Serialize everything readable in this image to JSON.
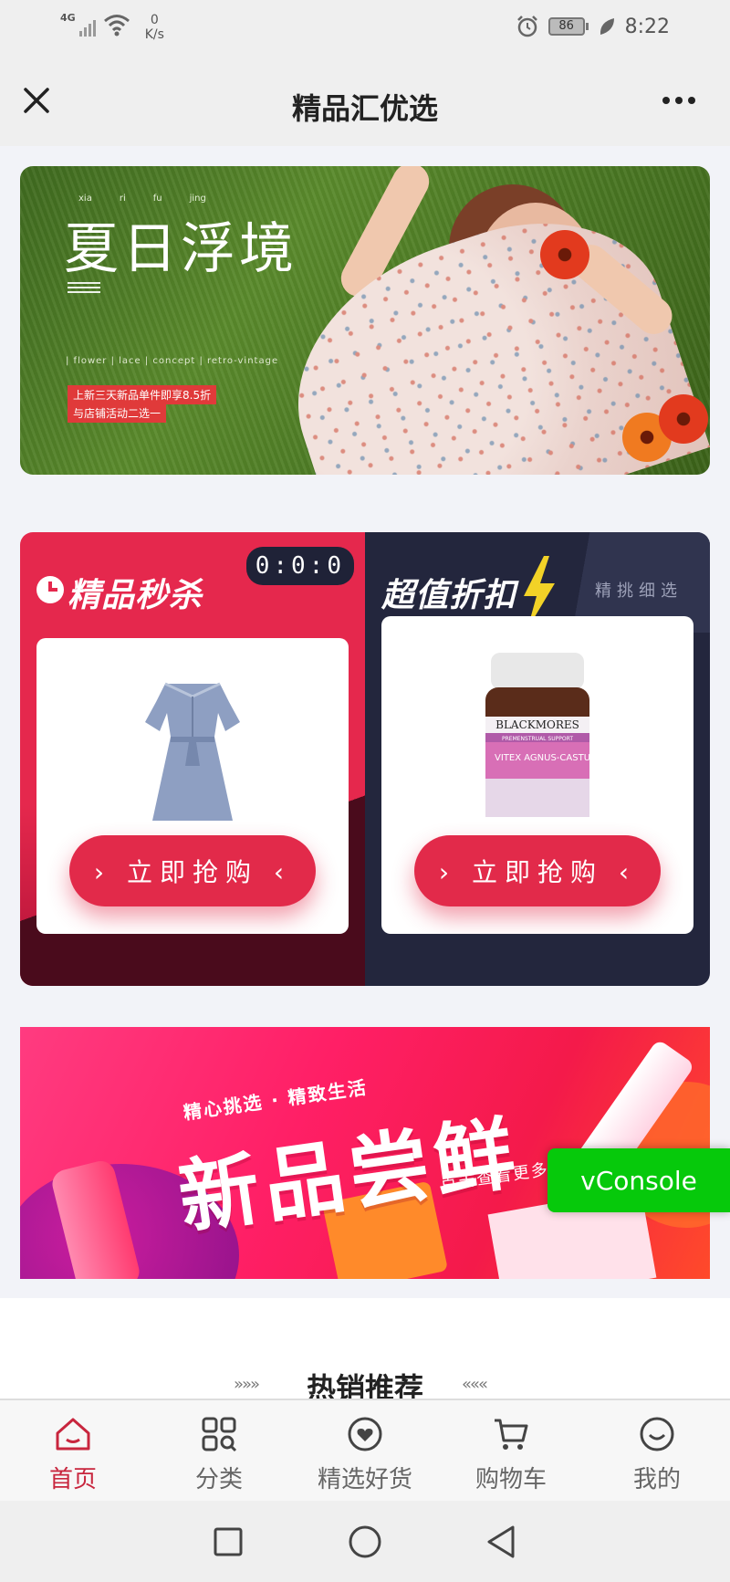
{
  "statusbar": {
    "network": "4G",
    "speed_value": "0",
    "speed_unit": "K/s",
    "battery": "86",
    "time": "8:22"
  },
  "navbar": {
    "title": "精品汇优选"
  },
  "banner": {
    "title": "夏日浮境",
    "pinyin": [
      "xia",
      "ri",
      "fu",
      "jing"
    ],
    "tags": "| flower | lace | concept | retro-vintage",
    "promo_line1": "上新三天新品单件即享8.5折",
    "promo_line2": "与店铺活动二选一"
  },
  "deals": {
    "flash": {
      "title": "精品秒杀",
      "countdown": "0:0:0",
      "button": "› 立即抢购 ‹"
    },
    "discount": {
      "title": "超值折扣",
      "subtitle": "精挑细选",
      "button": "› 立即抢购 ‹",
      "product_brand": "BLACKMORES",
      "product_sub": "PREMENSTRUAL SUPPORT",
      "product_name": "VITEX AGNUS-CASTUS"
    }
  },
  "new_banner": {
    "small": "精心挑选 · 精致生活",
    "big": "新品尝鲜",
    "more": "点击查看更多"
  },
  "vconsole": "vConsole",
  "hot": {
    "title": "热销推荐",
    "arrow_left": "»»»",
    "arrow_right": "«««"
  },
  "tabs": [
    {
      "label": "首页",
      "icon": "home-icon",
      "active": true
    },
    {
      "label": "分类",
      "icon": "category-icon",
      "active": false
    },
    {
      "label": "精选好货",
      "icon": "heart-badge-icon",
      "active": false
    },
    {
      "label": "购物车",
      "icon": "cart-icon",
      "active": false
    },
    {
      "label": "我的",
      "icon": "profile-icon",
      "active": false
    }
  ],
  "colors": {
    "accent": "#c8263e",
    "flash_red": "#e5284d",
    "discount_navy": "#23263d",
    "vconsole_green": "#06c90b"
  }
}
